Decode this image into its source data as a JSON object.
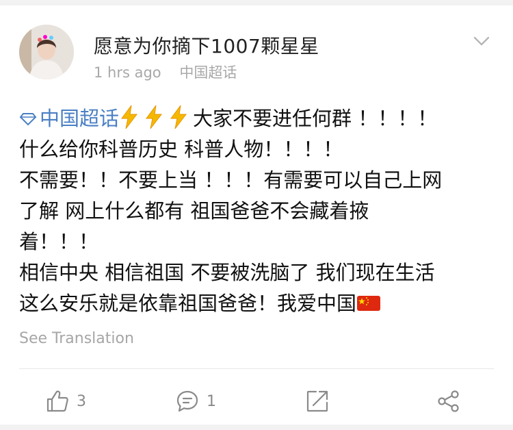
{
  "post": {
    "username": "愿意为你摘下1007颗星星",
    "time": "1 hrs ago",
    "topic": "中国超话",
    "content_topic": "中国超话",
    "lines": [
      "大家不要进任何群 ！！！！",
      "什么给你科普历史 科普人物！！！！",
      " 不需要！！不要上当 ！！！有需要可以自己上网",
      "了解 网上什么都有  祖国爸爸不会藏着掖",
      "着！！！",
      "相信中央 相信祖国 不要被洗脑了 我们现在生活",
      "这么安乐就是依靠祖国爸爸！我爱中国"
    ],
    "see_translation": "See Translation"
  },
  "actions": {
    "like_count": "3",
    "comment_count": "1"
  },
  "icons": {
    "avatar": "avatar-photo",
    "menu": "chevron-down-icon",
    "topic": "diamond-icon",
    "emoji": "lightning-bolt-emoji",
    "flag": "china-flag-emoji",
    "like": "thumbs-up-icon",
    "comment": "comment-icon",
    "repost": "repost-icon",
    "share": "share-icon"
  },
  "colors": {
    "topic_link": "#4a7fc4",
    "muted": "#a8a8a8",
    "bolt": "#f5b800",
    "flag_red": "#de2910",
    "flag_yellow": "#ffde00"
  }
}
